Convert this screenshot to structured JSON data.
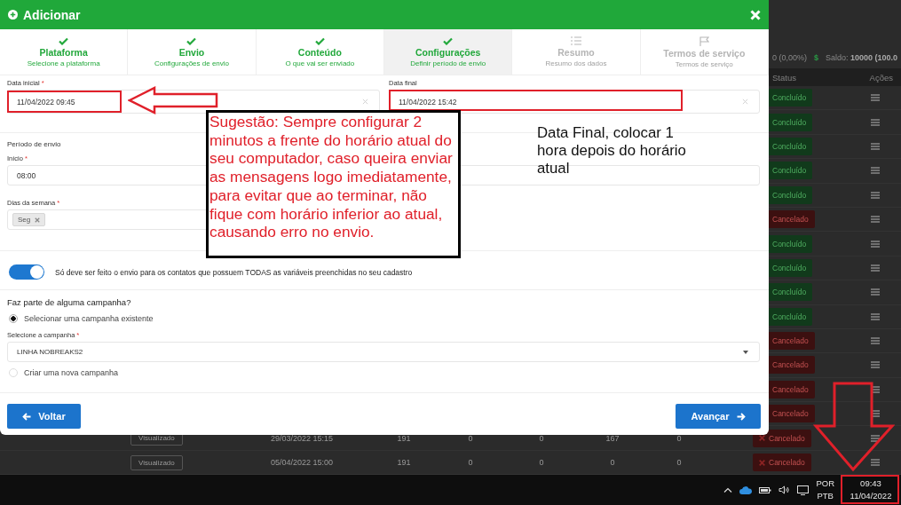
{
  "background": {
    "summary": "0 (0,00%)",
    "currency": "$",
    "balance": "Saldo: **10000 (100.0**",
    "columns": [
      "Status",
      "Ações"
    ],
    "rows": [
      {
        "status": "Concluído",
        "kind": "done"
      },
      {
        "status": "Concluído",
        "kind": "done"
      },
      {
        "status": "Concluído",
        "kind": "done"
      },
      {
        "status": "Concluído",
        "kind": "done"
      },
      {
        "status": "Concluído",
        "kind": "done"
      },
      {
        "status": "Cancelado",
        "kind": "cancelled"
      },
      {
        "status": "Concluído",
        "kind": "done"
      },
      {
        "status": "Concluído",
        "kind": "done"
      },
      {
        "status": "Concluído",
        "kind": "done"
      },
      {
        "status": "Concluído",
        "kind": "done"
      },
      {
        "status": "Cancelado",
        "kind": "cancelled"
      },
      {
        "status": "Cancelado",
        "kind": "cancelled"
      },
      {
        "status": "Cancelado",
        "kind": "cancelled"
      },
      {
        "status": "Cancelado",
        "kind": "cancelled"
      },
      {
        "view": "Visualizado",
        "date": "29/03/2022 15:15",
        "values": [
          "191",
          "0",
          "0",
          "167",
          "0"
        ],
        "status": "Cancelado",
        "kind": "cancelled"
      },
      {
        "view": "Visualizado",
        "date": "05/04/2022 15:00",
        "values": [
          "191",
          "0",
          "0",
          "0",
          "0"
        ],
        "status": "Cancelado",
        "kind": "cancelled"
      }
    ]
  },
  "dialog": {
    "title": "Adicionar",
    "steps": [
      {
        "title": "Plataforma",
        "subtitle": "Selecione a plataforma",
        "done": true,
        "selected": false
      },
      {
        "title": "Envio",
        "subtitle": "Configurações de envio",
        "done": true,
        "selected": false
      },
      {
        "title": "Conteúdo",
        "subtitle": "O que vai ser enviado",
        "done": true,
        "selected": false
      },
      {
        "title": "Configurações",
        "subtitle": "Definir período de envio",
        "done": true,
        "selected": true
      },
      {
        "title": "Resumo",
        "subtitle": "Resumo dos dados",
        "done": false,
        "selected": false
      },
      {
        "title": "Termos de serviço",
        "subtitle": "Termos de serviço",
        "done": false,
        "selected": false
      }
    ],
    "date_start": {
      "label": "Data inicial",
      "mark": "*",
      "value": "11/04/2022 09:45"
    },
    "date_end": {
      "label": "Data final",
      "value": "11/04/2022 15:42"
    },
    "period": {
      "title": "Período de envio",
      "start": {
        "label": "Início",
        "mark": "*",
        "value": "08:00"
      }
    },
    "weekdays": {
      "label": "Dias da semana",
      "mark": "*",
      "chips": [
        "Seg"
      ]
    },
    "toggle": {
      "on": true,
      "label": "Só deve ser feito o envio para os contatos que possuem TODAS as variáveis preenchidas no seu cadastro"
    },
    "campaign": {
      "question": "Faz parte de alguma campanha?",
      "options": [
        {
          "label": "Selecionar uma campanha existente",
          "selected": true
        },
        {
          "label": "Criar uma nova campanha",
          "selected": false
        }
      ],
      "select": {
        "label": "Selecione a campanha",
        "mark": "*",
        "value": "LINHA NOBREAKS2"
      }
    },
    "buttons": {
      "back": "Voltar",
      "next": "Avançar"
    }
  },
  "annotations": {
    "tip": "Sugestão: Sempre configurar 2 minutos a frente do horário atual do seu computador, caso queira enviar as mensagens logo imediatamente, para evitar que ao terminar, não fique com horário inferior ao atual, causando erro no envio.",
    "note": "Data Final, colocar 1 hora depois do horário atual"
  },
  "taskbar": {
    "language": "POR",
    "layout": "PTB",
    "time": "09:43",
    "date": "11/04/2022"
  }
}
